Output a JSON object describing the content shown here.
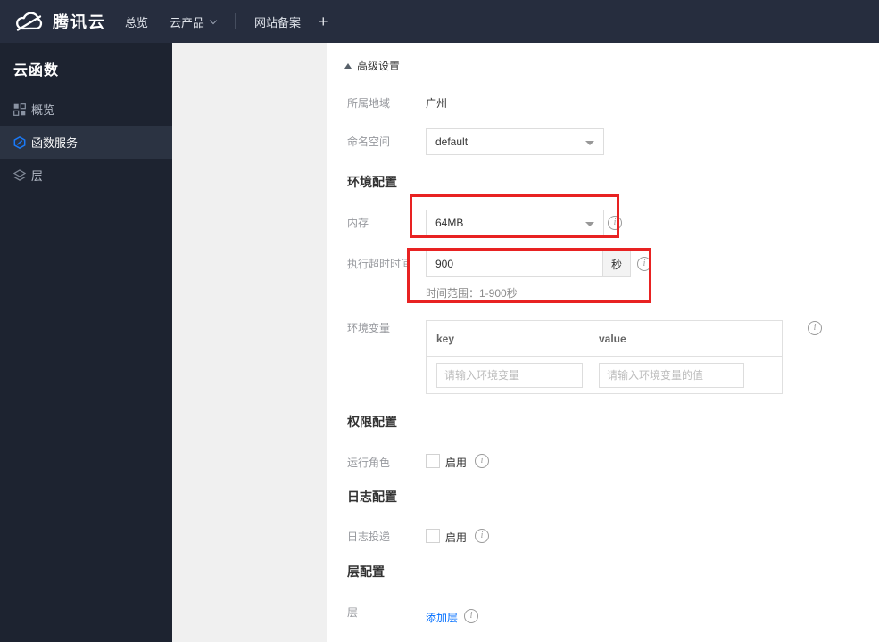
{
  "colors": {
    "accent_blue": "#006eff",
    "annotation_red": "#e82222",
    "topbar_bg": "#262d3e",
    "sidebar_bg": "#1d2330",
    "sidebar_selected_bg": "#2b3342"
  },
  "topbar": {
    "brand": "腾讯云",
    "nav": [
      {
        "label": "总览"
      },
      {
        "label": "云产品"
      },
      {
        "label": "网站备案"
      },
      {
        "label": "+"
      }
    ]
  },
  "sidebar": {
    "title": "云函数",
    "items": [
      {
        "label": "概览"
      },
      {
        "label": "函数服务"
      },
      {
        "label": "层"
      }
    ]
  },
  "form": {
    "advanced_label": "高级设置",
    "region": {
      "label": "所属地域",
      "value": "广州"
    },
    "namespace": {
      "label": "命名空间",
      "value": "default"
    },
    "section_env": "环境配置",
    "memory": {
      "label": "内存",
      "value": "64MB"
    },
    "timeout": {
      "label": "执行超时时间",
      "value": "900",
      "unit": "秒",
      "hint": "时间范围：1-900秒"
    },
    "env_vars": {
      "label": "环境变量",
      "key_header": "key",
      "value_header": "value",
      "key_placeholder": "请输入环境变量",
      "value_placeholder": "请输入环境变量的值"
    },
    "section_perm": "权限配置",
    "role": {
      "label": "运行角色",
      "toggle_label": "启用"
    },
    "section_log": "日志配置",
    "log_delivery": {
      "label": "日志投递",
      "toggle_label": "启用"
    },
    "section_layer": "层配置",
    "layer": {
      "label": "层",
      "add_link": "添加层"
    }
  }
}
